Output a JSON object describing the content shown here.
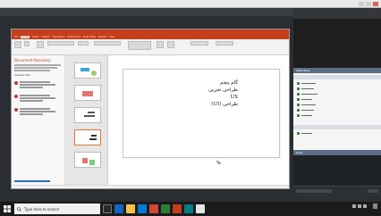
{
  "app": {
    "title": "",
    "menu": "",
    "window_buttons": [
      "minimize",
      "maximize",
      "close"
    ]
  },
  "powerpoint": {
    "tabs": [
      "File",
      "Home",
      "Insert",
      "Design",
      "Transitions",
      "Animations",
      "Slide Show",
      "Review",
      "View"
    ],
    "active_tab": "Home"
  },
  "recovery": {
    "title": "Document Recovery",
    "available_label": "Available files"
  },
  "slide": {
    "lines": [
      "گام پنجم",
      "طراحی تجربی",
      "UX",
      "(UI) طراحی"
    ]
  },
  "attendees": {
    "header": "Attendees",
    "people": [
      "",
      "",
      "",
      "",
      "",
      "",
      "",
      ""
    ]
  },
  "chat": {
    "header": "Chat",
    "messages": [
      "",
      "",
      "",
      "",
      "",
      "",
      "",
      ""
    ]
  },
  "taskbar": {
    "search_placeholder": "Type here to search",
    "time": "",
    "date": ""
  },
  "colors": {
    "ppt_accent": "#c43e1c",
    "panel_header": "#5b6e85",
    "taskbar": "#1b1b1b"
  }
}
